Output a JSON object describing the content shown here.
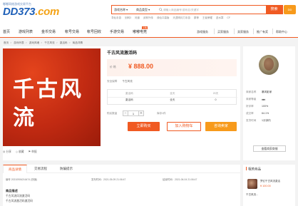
{
  "header": {
    "logo_tagline": "嘟嘟网络游戏交易平台",
    "logo_main": "DD373",
    "logo_suffix": ".com",
    "search_type": "游戏名称 ▾",
    "search_category": "商品类型 ▾",
    "search_placeholder": "请输入商品编号/游戏名/关键字",
    "search_button": "搜索",
    "hot_links": [
      "寻仙手游",
      "剑网3",
      "问道",
      "武林外传",
      "诛仙口袋版",
      "天涯明月刀手游",
      "原神",
      "王者荣耀",
      "逆水寒",
      "CF"
    ],
    "corner_logo": "DD"
  },
  "nav": {
    "items": [
      "首页",
      "游戏列表",
      "金币交易",
      "帐号交易",
      "帐号回收",
      "手游交易",
      "嘟嘟电竞"
    ],
    "hot_badge": "火热",
    "right": [
      "游戏服务",
      "买家服务",
      "卖家服务",
      "推广有奖",
      "帮助中心"
    ]
  },
  "breadcrumbs": [
    "首页",
    "游戏列表",
    "游戏风魂",
    "千古风流",
    "激活码",
    "商品详情"
  ],
  "product": {
    "title": "千古风流激活码",
    "image_text": "千古风流",
    "price_label": "价 格",
    "price": "¥ 888.00",
    "security_label": "安全保障",
    "security_value": "千古风流",
    "info": [
      {
        "k": "激活码",
        "v": "激活码"
      },
      {
        "k": "全天",
        "v": "全天"
      },
      {
        "k": "20天",
        "v": "0"
      }
    ],
    "qty_label": "购买数量",
    "qty_minus": "-",
    "qty_value": "1",
    "qty_plus": "+",
    "qty_stock": "库存1件",
    "buy_button": "立即购买",
    "cart_button": "加入购物车",
    "more_button": "咨询卖家",
    "img_actions": [
      "◎ 分享",
      "◇ 收藏",
      "⚑ 举报"
    ]
  },
  "seller": {
    "name_label": "商家名称",
    "name": "暴风影家",
    "level_label": "商家等级",
    "level": "♦♦♦",
    "rate_label": "好评率",
    "rate": "100%",
    "deal_label": "成交率",
    "deal": "64.1%",
    "time_label": "发货时间",
    "time": "1分钟内",
    "contact_button": "查看商家商铺"
  },
  "detail": {
    "tabs": [
      "商品详情",
      "交易流程",
      "防骗提示"
    ],
    "meta": [
      "编号 20210906216474 (快速)",
      "发布时间：2021-05-09 21:06:47",
      "结束时间：2021-06-04 21:06:47"
    ],
    "desc_title": "商品描述",
    "desc_lines": [
      "千古风流风流激活码",
      "千古风流激活码激活码"
    ]
  },
  "related": {
    "title": "相关商品",
    "item_title": "梦幻千古风流激活",
    "item_price": "¥ 100.00",
    "item_line2": "千古风流..."
  },
  "colors": {
    "accent": "#f05a22",
    "brand_blue": "#1d5fb8",
    "brand_orange": "#f4a316"
  }
}
